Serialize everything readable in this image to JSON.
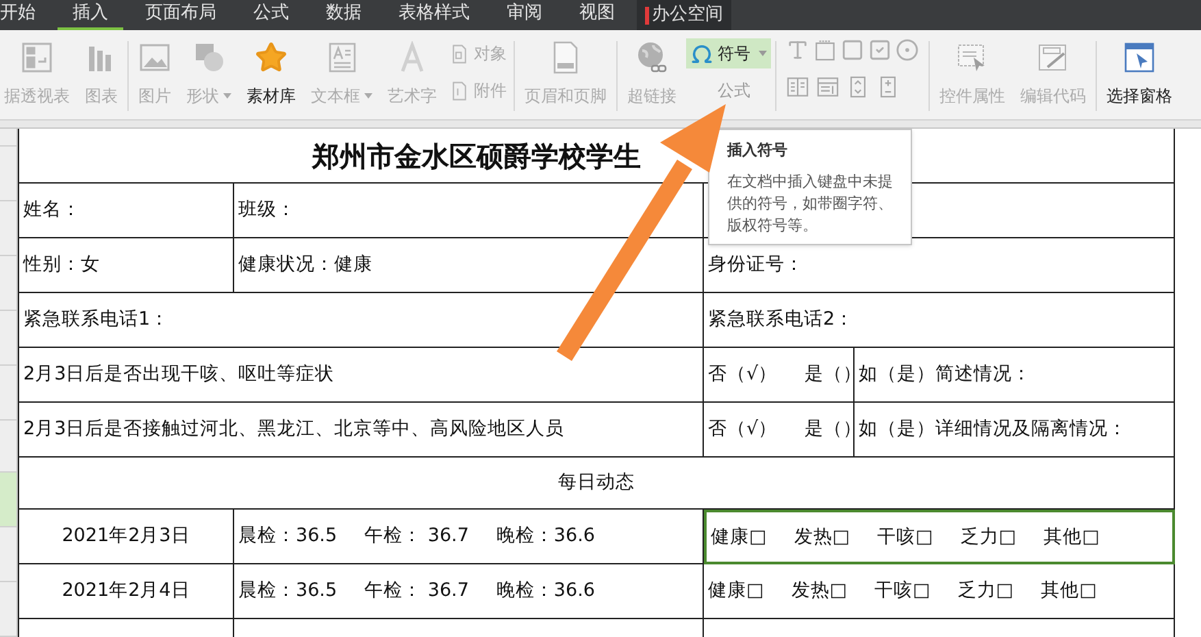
{
  "menu_tabs": [
    {
      "label": "开始",
      "selected": false,
      "kind": "tab"
    },
    {
      "label": "插入",
      "selected": true,
      "kind": "tab"
    },
    {
      "label": "页面布局",
      "selected": false,
      "kind": "tab"
    },
    {
      "label": "公式",
      "selected": false,
      "kind": "tab"
    },
    {
      "label": "数据",
      "selected": false,
      "kind": "tab"
    },
    {
      "label": "表格样式",
      "selected": false,
      "kind": "tab"
    },
    {
      "label": "审阅",
      "selected": false,
      "kind": "tab"
    },
    {
      "label": "视图",
      "selected": false,
      "kind": "tab"
    },
    {
      "label": "办公空间",
      "selected": false,
      "kind": "space"
    }
  ],
  "ribbon": [
    {
      "items": [
        {
          "label": "据透视表",
          "kind": "large",
          "disabled": true,
          "dropdown": false
        },
        {
          "label": "图表",
          "kind": "large",
          "disabled": true,
          "dropdown": false
        }
      ]
    },
    {
      "items": [
        {
          "label": "图片",
          "kind": "large",
          "disabled": true,
          "dropdown": false
        },
        {
          "label": "形状",
          "kind": "large",
          "disabled": true,
          "dropdown": true
        },
        {
          "label": "素材库",
          "kind": "large",
          "disabled": false,
          "dropdown": false
        },
        {
          "label": "文本框",
          "kind": "large",
          "disabled": true,
          "dropdown": true
        },
        {
          "label": "艺术字",
          "kind": "large",
          "disabled": true,
          "dropdown": false
        },
        {
          "label": "对象",
          "kind": "small",
          "disabled": true,
          "dropdown": false
        },
        {
          "label": "附件",
          "kind": "small",
          "disabled": true,
          "dropdown": false
        }
      ]
    },
    {
      "items": [
        {
          "label": "页眉和页脚",
          "kind": "large",
          "disabled": true,
          "dropdown": false
        }
      ]
    },
    {
      "items": [
        {
          "label": "超链接",
          "kind": "large",
          "disabled": true,
          "dropdown": false
        },
        {
          "label": "符号",
          "kind": "symbol",
          "disabled": false,
          "dropdown": true,
          "hovered": true
        },
        {
          "label": "公式",
          "kind": "plain",
          "disabled": true,
          "dropdown": false,
          "hovered": false
        }
      ]
    },
    {
      "items": [
        {
          "kind": "controls",
          "disabled": true
        }
      ]
    },
    {
      "items": [
        {
          "label": "控件属性",
          "kind": "large",
          "disabled": true,
          "dropdown": false
        },
        {
          "label": "编辑代码",
          "kind": "large",
          "disabled": true,
          "dropdown": false
        }
      ]
    },
    {
      "items": [
        {
          "label": "选择窗格",
          "kind": "large",
          "disabled": false,
          "dropdown": false
        }
      ]
    }
  ],
  "tooltip": {
    "title": "插入符号",
    "text": "在文档中插入键盘中未提供的符号，如带圈字符、版权符号等。"
  },
  "sheet": {
    "title": "郑州市金水区硕爵学校学生",
    "rows": [
      {
        "kind": "info",
        "cells": [
          [
            "姓名："
          ],
          [
            "班级："
          ],
          []
        ]
      },
      {
        "kind": "info",
        "cells": [
          [
            "性别：女"
          ],
          [
            "健康状况：健康"
          ],
          [
            "身份证号："
          ]
        ]
      },
      {
        "kind": "contact",
        "cells": [
          [
            "紧急联系电话1："
          ],
          [
            "紧急联系电话2："
          ]
        ]
      },
      {
        "kind": "question",
        "cells": [
          [
            "2月3日后是否出现干咳、呕吐等症状"
          ],
          [
            "否（√）",
            "是（）"
          ],
          [
            "如（是）简述情况："
          ]
        ]
      },
      {
        "kind": "question",
        "cells": [
          [
            "2月3日后是否接触过河北、黑龙江、北京等中、高风险地区人员"
          ],
          [
            "否（√）",
            "是（）"
          ],
          [
            "如（是）详细情况及隔离情况："
          ]
        ]
      },
      {
        "kind": "header",
        "cells": [
          [
            "每日动态"
          ]
        ]
      },
      {
        "kind": "daily",
        "selected": true,
        "cells": [
          [
            "2021年2月3日"
          ],
          [
            "晨检：36.5",
            "午检： 36.7",
            "晚检：36.6"
          ],
          [
            "健康□",
            "发热□",
            "干咳□",
            "乏力□",
            "其他□"
          ]
        ]
      },
      {
        "kind": "daily",
        "selected": false,
        "cells": [
          [
            "2021年2月4日"
          ],
          [
            "晨检：36.5",
            "午检： 36.7",
            "晚检：36.6"
          ],
          [
            "健康□",
            "发热□",
            "干咳□",
            "乏力□",
            "其他□"
          ]
        ]
      },
      {
        "kind": "empty"
      }
    ]
  }
}
